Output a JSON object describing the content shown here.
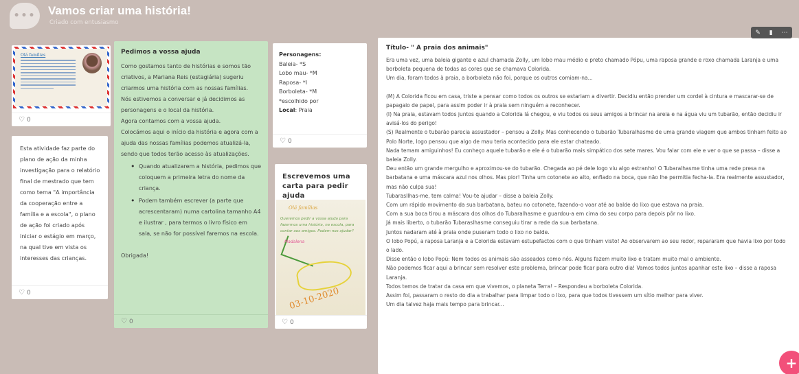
{
  "header": {
    "title": "Vamos criar uma história!",
    "subtitle": "Criado com entusiasmo"
  },
  "cards": {
    "image_card": {
      "image_caption": "Olá famílias",
      "likes": "0"
    },
    "intro_card": {
      "text": "Esta atividade faz parte do plano de ação da minha investigação para o relatório final de mestrado que tem como tema \"A importância da cooperação entre a família e a escola\", o plano de ação foi criado após iniciar o estágio em março, na qual tive em vista os interesses das crianças.",
      "likes": "0"
    },
    "help_card": {
      "title": "Pedimos a vossa ajuda",
      "paragraphs": [
        "Como gostamos tanto de histórias e somos tão criativos, a Mariana Reis (estagiária) sugeriu criarmos uma história com as nossas famílias.",
        "Nós estivemos a conversar e já decidimos as personagens e o local da história.",
        "Agora contamos com a vossa ajuda.",
        "Colocámos aqui o início da história e agora com a ajuda das nossas famílias podemos atualizá-la, sendo que todos terão acesso às atualizações."
      ],
      "bullets": [
        "Quando atualizarem a história, pedimos que coloquem a primeira letra do nome da criança.",
        "Podem também escrever (a parte que acrescentaram) numa cartolina tamanho A4 e ilustrar , para termos o livro físico em sala, se não for possível faremos na escola."
      ],
      "thanks": "Obrigada!",
      "likes": "0"
    },
    "characters_card": {
      "label": "Personagens:",
      "lines": "Baleia- *S\nLobo mau- *M\nRaposa- *I\nBorboleta- *M\n*escolhido por",
      "local_label": "Local",
      "local_value": ": Praia",
      "likes": "0"
    },
    "letter_card": {
      "title": "Escrevemos uma carta para pedir ajuda",
      "drawing_heading": "Olá famílias",
      "drawing_text": "Queremos pedir a vossa ajuda para fazermos uma história, na escola, para contar aos amigos. Podem nos ajudar?",
      "drawing_sign": "Madalena",
      "drawing_date": "03-10-2020",
      "likes": "0"
    },
    "story_card": {
      "title": "Título- \" A praia dos animais\"",
      "paragraphs": [
        " Era uma vez, uma baleia gigante e azul chamada Zolly, um lobo mau médio e preto chamado Pópu, uma raposa grande e roxo chamada Laranja e uma borboleta pequena de todas as cores que se chamava Colorida.",
        " Um dia, foram todos à praia, a borboleta não foi, porque os outros comiam-na...",
        "",
        "(M) A Colorida ficou em casa, triste a pensar como todos os outros se estariam a divertir. Decidiu então prender um cordel à cintura e mascarar-se de papagaio de papel, para assim poder ir à praia sem ninguém a reconhecer.",
        "(I) Na praia, estavam todos juntos quando a Colorida lá chegou, e viu todos os seus amigos a brincar na areia e na água viu um tubarão, então decidiu ir avisá-los do perigo!",
        "(S) Realmente o tubarão parecia assustador – pensou a Zolly. Mas conhecendo o tubarão Tubaralhasme de uma grande viagem que ambos tinham feito ao Polo Norte, logo pensou que algo de mau teria acontecido para ele estar chateado.",
        "Nada temam amiguinhos! Eu conheço aquele tubarão e ele é o tubarão mais simpático dos sete mares. Vou falar com ele e ver o que se passa – disse a baleia Zolly.",
        "Deu então um grande mergulho e aproximou-se do tubarão. Chegada ao pé dele logo viu algo estranho! O Tubaralhasme tinha uma rede presa na barbatana e uma máscara azul nos olhos. Mas pior! Tinha um cotonete ao alto, enfiado na boca, que não lhe permitia fecha-la. Era realmente assustador, mas não culpa sua!",
        "Tubarasllhas-me, tem calma! Vou-te ajudar – disse a baleia Zolly.",
        "Com um rápido movimento da sua barbatana, bateu no cotonete, fazendo-o voar até ao balde do lixo que estava na praia.",
        "Com a sua boca tirou a máscara dos olhos do Tubaralhasme e guardou-a em cima do seu corpo para depois pôr no lixo.",
        "Já mais liberto, o tubarão Tubaraslhasme conseguiu tirar a rede da sua barbatana.",
        "Juntos nadaram até à praia onde puseram todo o lixo no balde.",
        "O lobo Popú, a raposa Laranja e a Colorida estavam estupefactos com o que tinham visto! Ao observarem ao seu redor, repararam que havia lixo por todo o lado.",
        "Disse então o lobo Popú: Nem todos os animais são asseados como nós. Alguns fazem muito lixo e tratam muito mal o ambiente.",
        "Não podemos ficar aqui a brincar sem resolver este problema, brincar pode ficar para outro dia! Vamos todos juntos apanhar este lixo – disse a raposa Laranja.",
        "Todos temos de tratar da casa em que vivemos, o planeta Terra! – Respondeu a borboleta Colorida.",
        "Assim foi, passaram o resto do dia a trabalhar para limpar todo o lixo, para que todos tivessem um sítio melhor para viver.",
        "Um dia talvez haja mais tempo para brincar..."
      ]
    }
  },
  "toolbar": {
    "edit_icon": "pencil",
    "delete_icon": "trash",
    "more_icon": "ellipsis"
  },
  "fab": {
    "label": "+"
  }
}
